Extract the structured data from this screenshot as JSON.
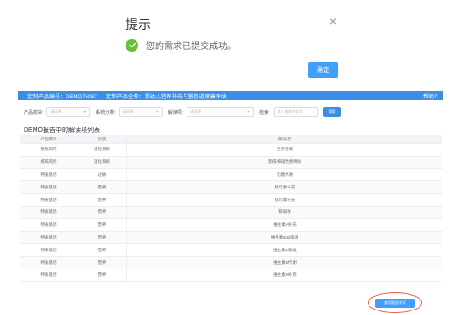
{
  "dialog": {
    "title": "提示",
    "close": "×",
    "message": "您的需求已提交成功。",
    "ok_label": "确定"
  },
  "header": {
    "product_code": "定制产品编号：DEMO76087",
    "product_name": "定制产品全称：婴幼儿营养补充与膳肠道健康评估",
    "help": "帮助？"
  },
  "filters": {
    "module_label": "产品模块:",
    "module_placeholder": "请选择",
    "system_label": "系统分类:",
    "system_placeholder": "请选择",
    "item_label": "解读项:",
    "item_placeholder": "请选择",
    "keyword_label": "检索:",
    "keyword_placeholder": "输入查询关键字",
    "search_label": "搜索"
  },
  "section_title": "DEMO报告中的解读项列表",
  "table": {
    "headers": [
      "产品模块",
      "分类",
      "解读项"
    ],
    "rows": [
      [
        "疾病风险",
        "消化系统",
        "克罗恩病"
      ],
      [
        "疾病风险",
        "消化系统",
        "溃疡/细菌性肠胃炎"
      ],
      [
        "特质基因",
        "过敏",
        "乳糖代谢"
      ],
      [
        "特质基因",
        "营养",
        "钙元素补充"
      ],
      [
        "特质基因",
        "营养",
        "镁元素补充"
      ],
      [
        "特质基因",
        "营养",
        "铁吸收"
      ],
      [
        "特质基因",
        "营养",
        "维生素A补充"
      ],
      [
        "特质基因",
        "营养",
        "维生素B12吸收"
      ],
      [
        "特质基因",
        "营养",
        "维生素D吸收"
      ],
      [
        "特质基因",
        "营养",
        "维生素E代谢"
      ],
      [
        "特质基因",
        "营养",
        "维生素K补充"
      ]
    ]
  },
  "bottom_button": "查看报告样式"
}
